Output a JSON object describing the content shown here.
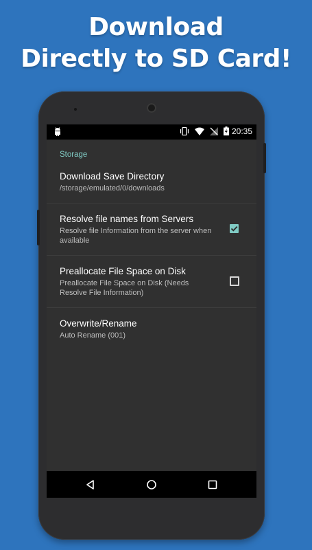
{
  "promo": {
    "line1": "Download",
    "line2": "Directly to SD Card!"
  },
  "status_bar": {
    "time": "20:35",
    "icons": [
      "android-icon",
      "vibrate-icon",
      "wifi-icon",
      "no-signal-icon",
      "battery-charging-icon"
    ]
  },
  "settings": {
    "section_header": "Storage",
    "items": [
      {
        "title": "Download Save Directory",
        "summary": "/storage/emulated/0/downloads"
      },
      {
        "title": "Resolve file names from Servers",
        "summary": "Resolve file Information from the server when available",
        "checked": true
      },
      {
        "title": "Preallocate File Space on Disk",
        "summary": "Preallocate File Space on Disk (Needs Resolve File Information)",
        "checked": false
      },
      {
        "title": "Overwrite/Rename",
        "summary": "Auto Rename (001)"
      }
    ]
  },
  "navbar": {
    "buttons": [
      "back-icon",
      "home-icon",
      "recents-icon"
    ]
  },
  "colors": {
    "background": "#2e74bd",
    "accent": "#80cbc4",
    "screen": "#303030"
  }
}
